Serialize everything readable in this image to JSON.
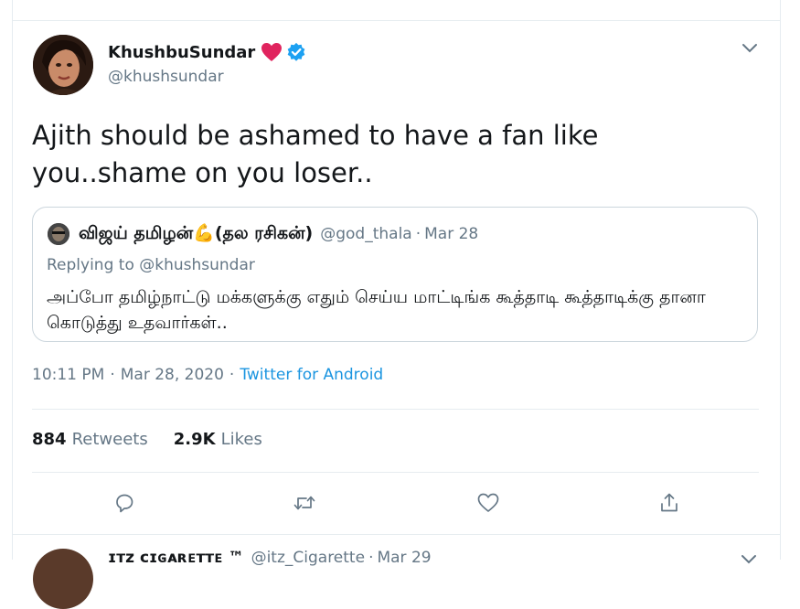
{
  "colors": {
    "text": "#14171a",
    "muted": "#657786",
    "link": "#1b95e0",
    "border": "#e6ecf0",
    "verified": "#1da1f2",
    "heart": "#e0245e"
  },
  "tweet": {
    "display_name": "KhushbuSundar",
    "handle": "@khushsundar",
    "icons": [
      "red-heart-icon",
      "verified-badge-icon",
      "chevron-down-icon"
    ],
    "text": "Ajith should be ashamed to have a fan like you..shame on you loser..",
    "time": "10:11 PM",
    "date": "Mar 28, 2020",
    "separator": "·",
    "source": "Twitter for Android",
    "retweets_count": "884",
    "retweets_label": "Retweets",
    "likes_count": "2.9K",
    "likes_label": "Likes"
  },
  "quoted": {
    "display_name": "விஜய் தமிழன்💪(தல ரசிகன்)",
    "handle": "@god_thala",
    "separator": "·",
    "date": "Mar 28",
    "replying_prefix": "Replying to",
    "replying_mention": "@khushsundar",
    "text": "அப்போ தமிழ்நாட்டு மக்களுக்கு எதும் செய்ய மாட்டிங்க கூத்தாடி கூத்தாடிக்கு தானா கொடுத்து உதவார்கள்.."
  },
  "actions": [
    "reply-icon",
    "retweet-icon",
    "like-icon",
    "share-icon"
  ],
  "next_tweet": {
    "display_name": "ɪᴛᴢ ᴄɪɢᴀʀᴇᴛᴛᴇ ™",
    "handle": "@itz_Cigarette",
    "separator": "·",
    "date": "Mar 29"
  }
}
